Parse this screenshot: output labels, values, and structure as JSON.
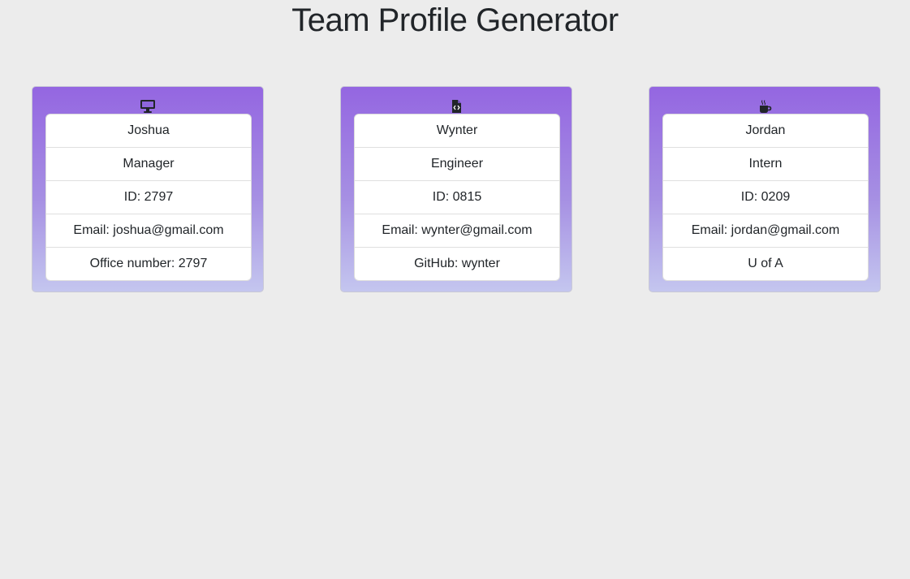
{
  "header": {
    "title": "Team Profile Generator"
  },
  "employees": [
    {
      "icon": "desktop-icon",
      "name": "Joshua",
      "role": "Manager",
      "id": "ID: 2797",
      "email": "Email: joshua@gmail.com",
      "extra": "Office number: 2797"
    },
    {
      "icon": "file-code-icon",
      "name": "Wynter",
      "role": "Engineer",
      "id": "ID: 0815",
      "email": "Email: wynter@gmail.com",
      "extra": "GitHub: wynter"
    },
    {
      "icon": "coffee-mug-icon",
      "name": "Jordan",
      "role": "Intern",
      "id": "ID: 0209",
      "email": "Email: jordan@gmail.com",
      "extra": "U of A"
    }
  ],
  "colors": {
    "background": "#ececec",
    "card_gradient_top": "#9466e1",
    "card_gradient_bottom": "#c4c6ef",
    "text": "#212529"
  }
}
